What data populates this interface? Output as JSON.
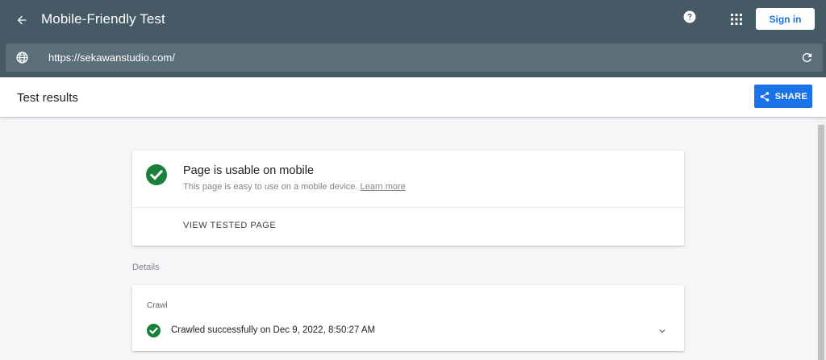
{
  "header": {
    "app_title": "Mobile-Friendly Test",
    "back_icon": "arrow-left-icon",
    "help_icon": "help-circle-icon",
    "apps_icon": "apps-grid-icon",
    "sign_in_label": "Sign in"
  },
  "url_bar": {
    "url": "https://sekawanstudio.com/",
    "globe_icon": "globe-icon",
    "reload_icon": "reload-icon"
  },
  "results": {
    "title": "Test results",
    "share_label": "SHARE",
    "share_icon": "share-icon"
  },
  "usable_card": {
    "title": "Page is usable on mobile",
    "description": "This page is easy to use on a mobile device.",
    "learn_more": "Learn more",
    "view_tested_label": "VIEW TESTED PAGE"
  },
  "details": {
    "label": "Details",
    "crawl_label": "Crawl",
    "crawl_status": "Crawled successfully on Dec 9, 2022, 8:50:27 AM"
  },
  "colors": {
    "header_bg": "#455a64",
    "url_bar_bg": "#5b6f78",
    "accent_blue": "#1a73e8",
    "success_green": "#188038"
  }
}
